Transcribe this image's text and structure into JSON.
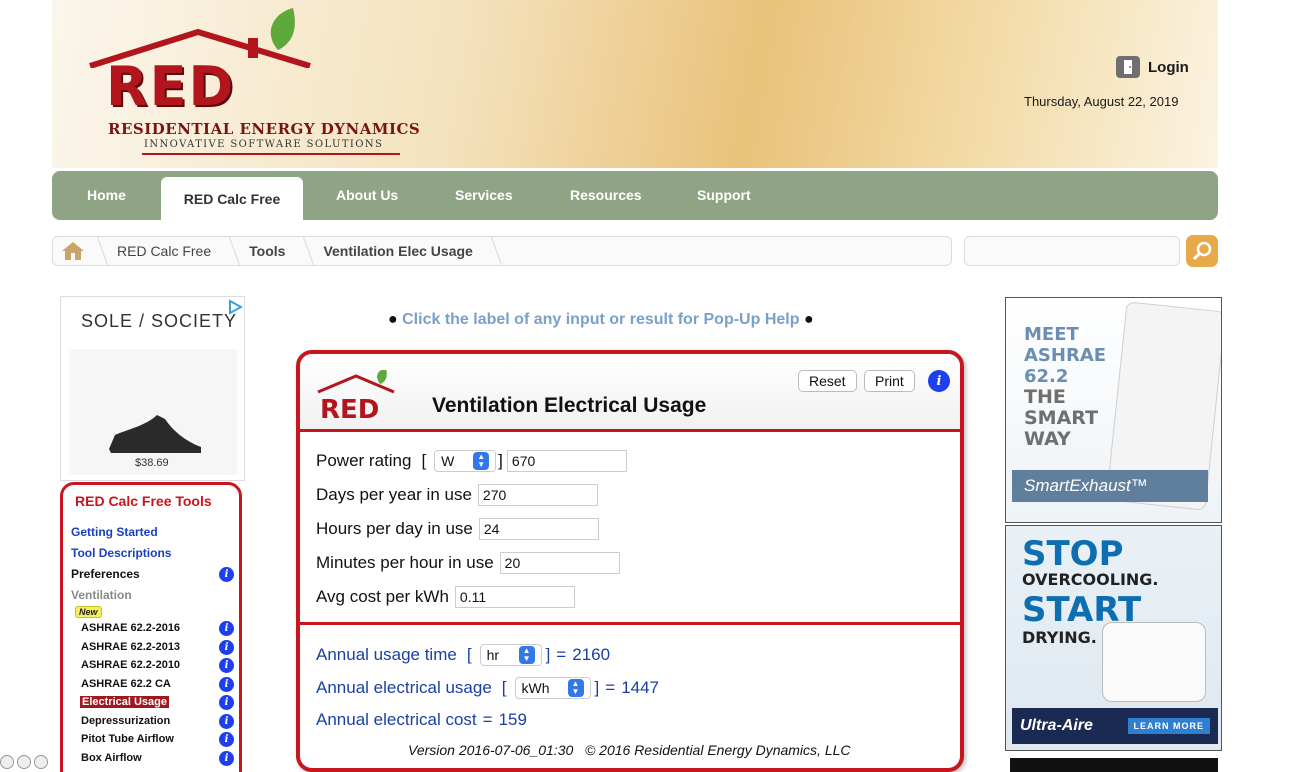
{
  "header": {
    "logo_text": "RED",
    "company_name": "Residential Energy Dynamics",
    "tagline": "Innovative Software Solutions",
    "login_label": "Login",
    "date": "Thursday, August 22, 2019"
  },
  "nav": {
    "items": [
      "Home",
      "RED Calc Free",
      "About Us",
      "Services",
      "Resources",
      "Support"
    ],
    "active": "RED Calc Free"
  },
  "breadcrumb": [
    "RED Calc Free",
    "Tools",
    "Ventilation Elec Usage"
  ],
  "search": {
    "value": "",
    "placeholder": ""
  },
  "ad_left": {
    "brand": "SOLE / SOCIETY",
    "price": "$38.69"
  },
  "tools": {
    "title": "RED Calc Free Tools",
    "getting_started": "Getting Started",
    "tool_descriptions": "Tool Descriptions",
    "preferences": "Preferences",
    "ventilation": "Ventilation",
    "new_badge": "New",
    "items": [
      "ASHRAE 62.2-2016",
      "ASHRAE 62.2-2013",
      "ASHRAE 62.2-2010",
      "ASHRAE 62.2 CA",
      "Electrical Usage",
      "Depressurization",
      "Pitot Tube Airflow",
      "Box Airflow"
    ],
    "active_item": "Electrical Usage"
  },
  "hint": "Click the label of any input or result for Pop-Up Help",
  "calculator": {
    "logo_text": "RED",
    "title": "Ventilation Electrical Usage",
    "reset_label": "Reset",
    "print_label": "Print",
    "info_glyph": "i",
    "inputs": {
      "power_rating": {
        "label": "Power rating",
        "unit": "W",
        "value": "670"
      },
      "days_per_year": {
        "label": "Days per year in use",
        "value": "270"
      },
      "hours_per_day": {
        "label": "Hours per day in use",
        "value": "24"
      },
      "minutes_per_hour": {
        "label": "Minutes per hour in use",
        "value": "20"
      },
      "avg_cost": {
        "label": "Avg cost per kWh",
        "value": "0.11"
      }
    },
    "results": {
      "annual_usage_time": {
        "label": "Annual usage time",
        "unit": "hr",
        "value": "2160"
      },
      "annual_electrical_usage": {
        "label": "Annual electrical usage",
        "unit": "kWh",
        "value": "1447"
      },
      "annual_electrical_cost": {
        "label": "Annual electrical cost",
        "value": "159"
      }
    },
    "version": "Version 2016-07-06_01:30",
    "copyright": "© 2016 Residential Energy Dynamics, LLC"
  },
  "ad_right_1": {
    "lines": [
      "MEET",
      "ASHRAE",
      "62.2",
      "THE",
      "SMART",
      "WAY"
    ],
    "band_text": "SmartExhaust™"
  },
  "ad_right_2": {
    "stop": "STOP",
    "overcooling": "OVERCOOLING.",
    "start": "START",
    "drying": "DRYING.",
    "brand": "Ultra-Aire",
    "learn_more": "LEARN MORE"
  },
  "colors": {
    "brand_red": "#c8161e",
    "nav_green": "#8fa385",
    "link_blue": "#1a3fbf",
    "info_blue": "#1d3ff0",
    "result_blue": "#1a3fa6"
  }
}
